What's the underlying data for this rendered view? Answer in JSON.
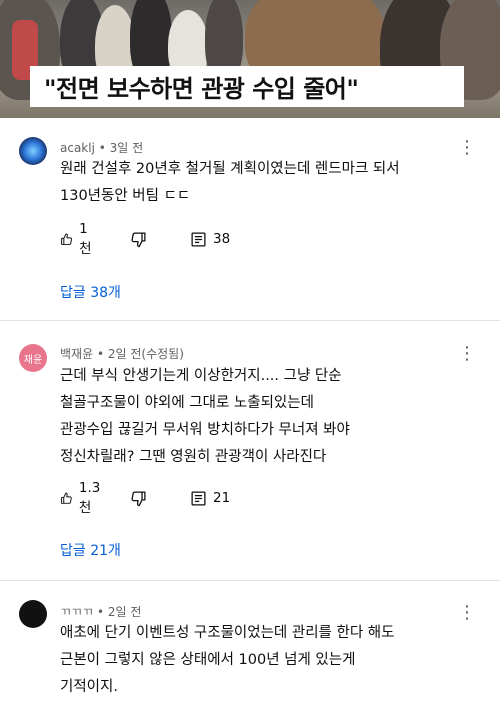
{
  "video": {
    "caption": "\"전면 보수하면 관광 수입 줄어\""
  },
  "comments": [
    {
      "author": "acaklj",
      "time": "3일 전",
      "lines": [
        "원래 건설후 20년후 철거될 계획이였는데 렌드마크 되서",
        "130년동안 버팀 ㄷㄷ"
      ],
      "likes": "1천",
      "reply_count": "38",
      "replies_link": "답글 38개",
      "avatar_color": "#2b73d8"
    },
    {
      "author": "백재윤",
      "time": "2일 전(수정됨)",
      "avatar_text": "재윤",
      "lines": [
        "근데 부식 안생기는게 이상한거지.... 그냥 단순",
        "철골구조물이 야외에 그대로 노출되있는데",
        "관광수입 끊길거 무서워 방치하다가 무너져 봐야",
        "정신차릴래? 그땐 영원히 관광객이 사라진다"
      ],
      "likes": "1.3천",
      "reply_count": "21",
      "replies_link": "답글 21개",
      "avatar_color": "#e8758c"
    },
    {
      "author": "ㄲㄲㄲ",
      "time": "2일 전",
      "lines": [
        "애초에 단기 이벤트성 구조물이었는데 관리를 한다 해도",
        "근본이 그렇지 않은 상태에서 100년 넘게 있는게",
        "기적이지."
      ],
      "avatar_color": "#111111"
    }
  ],
  "icons": {
    "like": "thumbs-up-icon",
    "dislike": "thumbs-down-icon",
    "reply": "comment-icon",
    "more": "more-vertical-icon"
  }
}
